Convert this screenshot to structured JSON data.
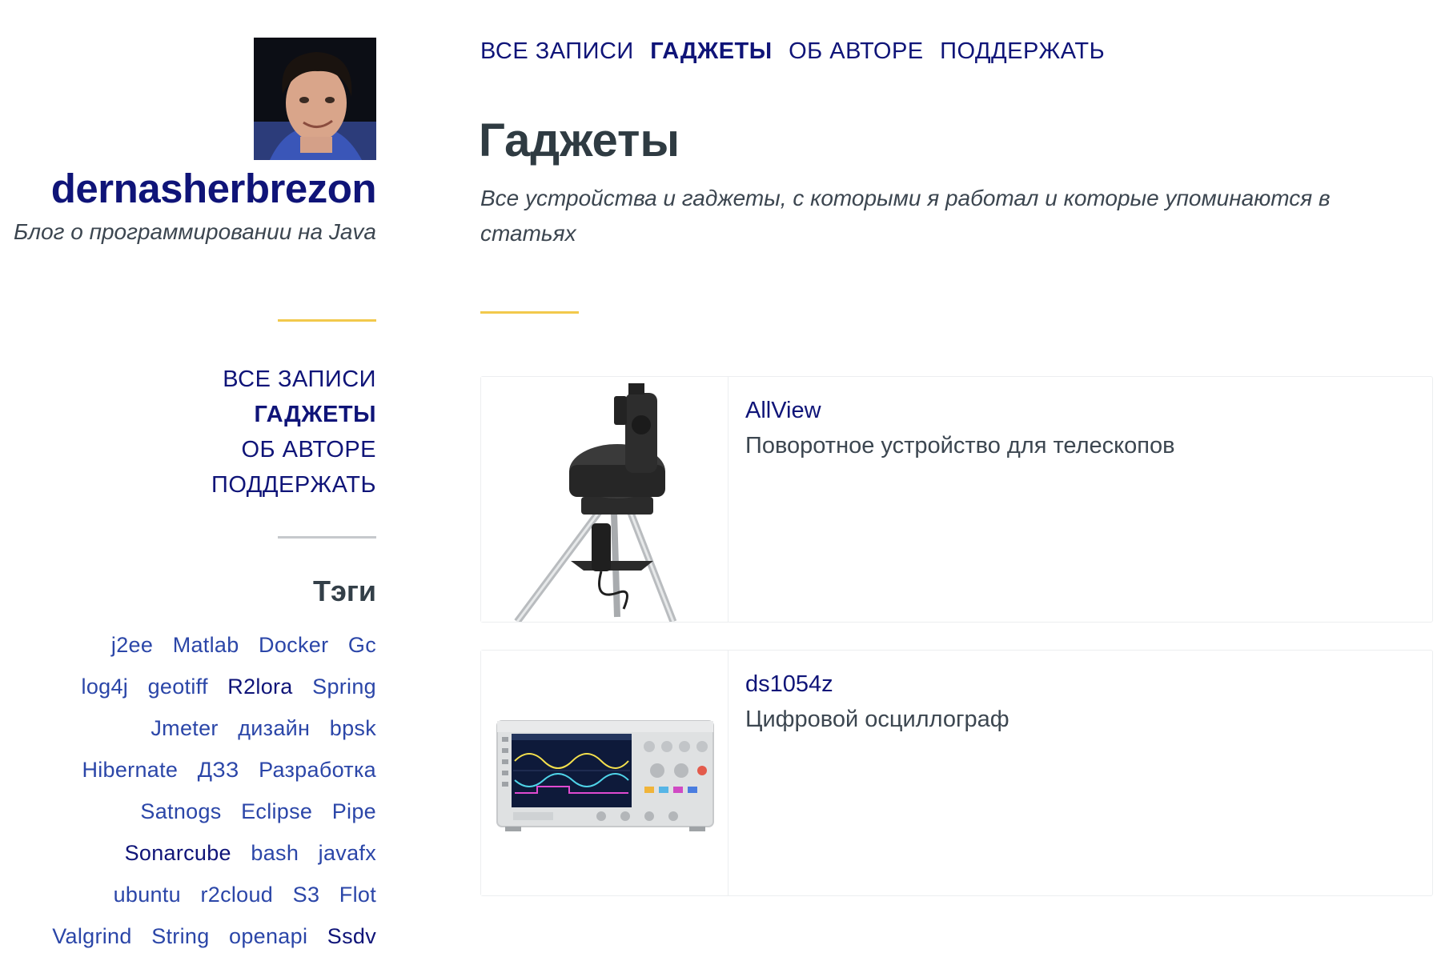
{
  "site": {
    "title": "dernasherbrezon",
    "description": "Блог о программировании на Java"
  },
  "nav": [
    {
      "label": "ВСЕ ЗАПИСИ",
      "active": false
    },
    {
      "label": "ГАДЖЕТЫ",
      "active": true
    },
    {
      "label": "ОБ АВТОРЕ",
      "active": false
    },
    {
      "label": "ПОДДЕРЖАТЬ",
      "active": false
    }
  ],
  "tags": {
    "title": "Тэги",
    "items": [
      "j2ee",
      "Matlab",
      "Docker",
      "Gc",
      "log4j",
      "geotiff",
      "R2lora",
      "Spring",
      "Jmeter",
      "дизайн",
      "bpsk",
      "Hibernate",
      "ДЗЗ",
      "Разработка",
      "Satnogs",
      "Eclipse",
      "Pipe",
      "Sonarcube",
      "bash",
      "javafx",
      "ubuntu",
      "r2cloud",
      "S3",
      "Flot",
      "Valgrind",
      "String",
      "openapi",
      "Ssdv"
    ]
  },
  "page": {
    "title": "Гаджеты",
    "description": "Все устройства и гаджеты, с которыми я работал и которые упоминаются в статьях"
  },
  "gadgets": [
    {
      "name": "AllView",
      "description": "Поворотное устройство для телескопов",
      "image": "telescope-mount"
    },
    {
      "name": "ds1054z",
      "description": "Цифровой осциллограф",
      "image": "oscilloscope"
    }
  ],
  "colors": {
    "link": "#0f1478",
    "tag": "#2b46a8",
    "accent_rule": "#f2c94c",
    "divider": "#c6c9cd",
    "text": "#333f48"
  }
}
